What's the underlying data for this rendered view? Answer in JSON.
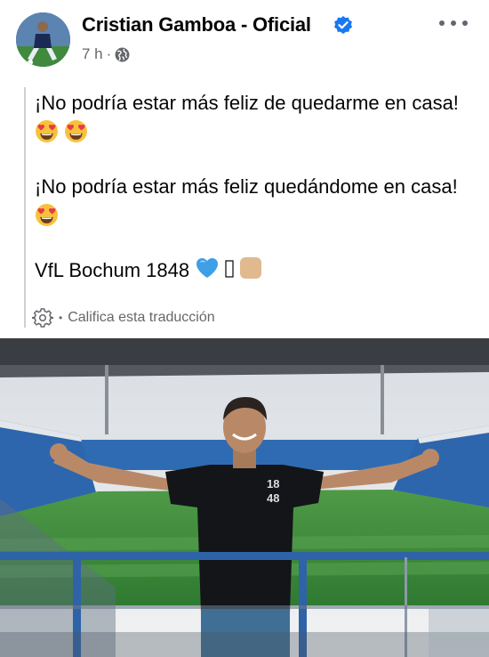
{
  "post": {
    "author": "Cristian Gamboa - Oficial",
    "time": "7 h",
    "meta_dot": "·",
    "paragraphs": [
      "¡No podría estar más feliz de quedarme en casa!",
      "¡No podría estar más feliz quedándome en casa!",
      "VfL Bochum 1848"
    ],
    "rate_dot": "•",
    "rate_translation": "Califica esta traducción"
  },
  "photo": {
    "shirt_number_top": "18",
    "shirt_number_bottom": "48"
  },
  "colors": {
    "verified_blue": "#1877f2",
    "meta_gray": "#65676b",
    "stadium_seat_blue": "#2f6bb3",
    "pitch_green": "#3f8e3a",
    "railing_blue": "#2f63a8"
  },
  "icons": {
    "verified": "verified-badge-icon",
    "globe": "globe-icon",
    "more": "more-options-icon",
    "gear": "gear-icon",
    "heart_eyes": "heart-eyes-emoji",
    "blue_heart": "blue-heart-emoji",
    "skin_square": "skin-tone-square-emoji"
  }
}
